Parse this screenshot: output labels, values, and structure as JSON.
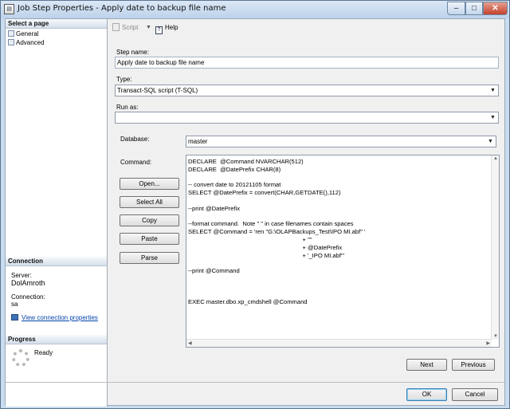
{
  "window": {
    "title": "Job Step Properties - Apply date to backup file name",
    "controls": {
      "minimize": "–",
      "maximize": "□",
      "close": "✕"
    }
  },
  "left_pane": {
    "select_page_header": "Select a page",
    "pages": [
      "General",
      "Advanced"
    ],
    "connection_header": "Connection",
    "server_label": "Server:",
    "server_value": "DolAmroth",
    "connection_label": "Connection:",
    "connection_value": "sa",
    "view_connection_link": "View connection properties",
    "progress_header": "Progress",
    "progress_status": "Ready"
  },
  "toolbar": {
    "script_label": "Script",
    "dropdown_arrow": "▼",
    "help_label": "Help"
  },
  "form": {
    "step_name_label": "Step name:",
    "step_name_value": "Apply date to backup file name",
    "type_label": "Type:",
    "type_value": "Transact-SQL script (T-SQL)",
    "run_as_label": "Run as:",
    "run_as_value": "",
    "database_label": "Database:",
    "database_value": "master",
    "command_label": "Command:"
  },
  "command_buttons": {
    "open": "Open...",
    "select_all": "Select All",
    "copy": "Copy",
    "paste": "Paste",
    "parse": "Parse"
  },
  "command_text": [
    "DECLARE  @Command NVARCHAR(512)",
    "DECLARE  @DatePrefix CHAR(8)",
    "",
    "-- convert date to 20121105 format",
    "SELECT @DatePrefix = convert(CHAR,GETDATE(),112)",
    "",
    "--print @DatePrefix",
    "",
    "--format command.  Note \" \" in case filenames contain spaces",
    "SELECT @Command = 'ren \"G:\\OLAPBackups_Test\\IPO MI.abf\" '",
    "                                                                    + '\"'",
    "                                                                    + @DatePrefix",
    "                                                                    + '_IPO MI.abf\"'",
    "",
    "--print @Command",
    "",
    "",
    "",
    "EXEC master.dbo.xp_cmdshell @Command"
  ],
  "nav_buttons": {
    "next": "Next",
    "previous": "Previous"
  },
  "footer_buttons": {
    "ok": "OK",
    "cancel": "Cancel"
  },
  "icons": {
    "window": "job-step-icon",
    "page": "page-icon",
    "link": "connection-properties-icon",
    "spinner": "progress-spinner-icon",
    "script": "script-icon",
    "help": "help-icon"
  }
}
